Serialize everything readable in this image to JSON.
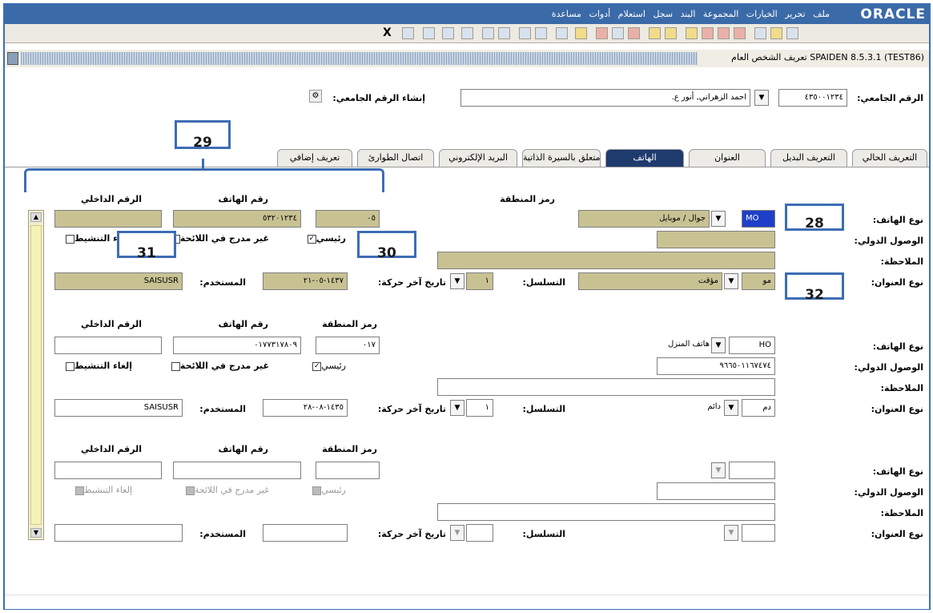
{
  "app": {
    "logo": "ORACLE",
    "menus": [
      "ملف",
      "تحرير",
      "الخيارات",
      "المجموعة",
      "البند",
      "سجل",
      "استعلام",
      "أدوات",
      "مساعدة"
    ],
    "exit_label": "X"
  },
  "window": {
    "title": "تعريف الشخص العام  SPAIDEN 8.5.3.1  (TEST86)"
  },
  "key_block": {
    "id_label": "الرقم الجامعي:",
    "id_value": "٤٣٥٠٠١٢٣٤",
    "name_value": "احمد الزهراني, أنور ع.",
    "generate_label": "إنشاء الرقم الجامعي:"
  },
  "tabs": [
    {
      "label": "التعريف الحالي",
      "active": false
    },
    {
      "label": "التعريف البديل",
      "active": false
    },
    {
      "label": "العنوان",
      "active": false
    },
    {
      "label": "الهاتف",
      "active": true
    },
    {
      "label": "متعلق بالسيرة الذاتية",
      "active": false
    },
    {
      "label": "البريد الإلكتروني",
      "active": false
    },
    {
      "label": "اتصال الطوارئ",
      "active": false
    },
    {
      "label": "تعريف إضافي",
      "active": false
    }
  ],
  "labels": {
    "phone_type": "نوع الهاتف:",
    "intl_access": "الوصول الدولي:",
    "comment": "الملاحظة:",
    "address_type": "نوع العنوان:",
    "area_code": "رمز المنطقة",
    "phone_number": "رقم الهاتف",
    "extension": "الرقم الداخلي",
    "primary": "رئيسي",
    "unlisted": "غير مدرج في اللائحة",
    "inactivate": "إلغاء التنشيط",
    "user": "المستخدم:",
    "activity_date": "تاريخ آخر حركة:",
    "sequence": "التسلسل:"
  },
  "phones": [
    {
      "phone_type_code": "MO",
      "phone_type_desc": "جوال / موبايل",
      "intl_access": "",
      "comment": "",
      "address_type_code": "مو",
      "address_type_desc": "مؤقت",
      "sequence": "١",
      "activity_date": "١٤٣٧-٠٥-٢١",
      "user": "SAISUSR",
      "area_code": "٠٥",
      "phone_number": "٥٣٢٠١٢٣٤",
      "extension": "",
      "primary": true,
      "unlisted": false,
      "inactivate": false
    },
    {
      "phone_type_code": "HO",
      "phone_type_desc": "هاتف المنزل",
      "intl_access": "٩٦٦٥٠١١٦٧٤٧٤",
      "comment": "",
      "address_type_code": "دم",
      "address_type_desc": "دائم",
      "sequence": "١",
      "activity_date": "١٤٣٥-٠٨-٢٨",
      "user": "SAISUSR",
      "area_code": "٠١٧",
      "phone_number": "٠١٧٧٣١٧٨٠٩",
      "extension": "",
      "primary": true,
      "unlisted": false,
      "inactivate": false
    },
    {
      "phone_type_code": "",
      "phone_type_desc": "",
      "intl_access": "",
      "comment": "",
      "address_type_code": "",
      "address_type_desc": "",
      "sequence": "",
      "activity_date": "",
      "user": "",
      "area_code": "",
      "phone_number": "",
      "extension": "",
      "primary": false,
      "unlisted": false,
      "inactivate": false
    }
  ],
  "callouts": {
    "c28": "28",
    "c29": "29",
    "c30": "30",
    "c31": "31",
    "c32": "32"
  },
  "colors": {
    "required_field": "#c8c293",
    "accent_blue": "#3d6db3",
    "menubar": "#3b6aa8",
    "active_tab": "#1f3b6e"
  }
}
